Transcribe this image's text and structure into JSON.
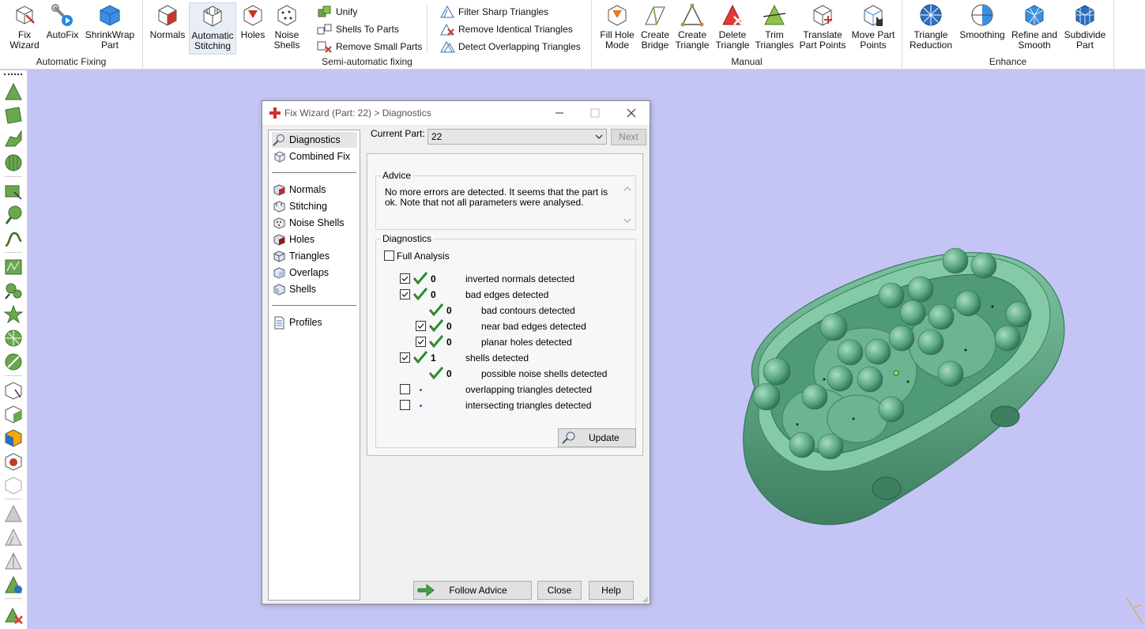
{
  "ribbon": {
    "groups": [
      {
        "label": "Automatic Fixing",
        "buttons": [
          {
            "label": "Fix\nWizard",
            "icon": "fix-wizard-icon"
          },
          {
            "label": "AutoFix",
            "icon": "autofix-icon"
          },
          {
            "label": "ShrinkWrap\nPart",
            "icon": "shrinkwrap-icon"
          }
        ]
      },
      {
        "label": "Semi-automatic fixing",
        "buttons": [
          {
            "label": "Normals",
            "icon": "normals-icon"
          },
          {
            "label": "Automatic\nStitching",
            "icon": "stitching-icon"
          },
          {
            "label": "Holes",
            "icon": "holes-icon"
          },
          {
            "label": "Noise\nShells",
            "icon": "noise-shells-icon"
          }
        ],
        "small_buttons": [
          {
            "label": "Unify"
          },
          {
            "label": "Shells To Parts"
          },
          {
            "label": "Remove Small Parts"
          },
          {
            "label": "Filter Sharp Triangles"
          },
          {
            "label": "Remove Identical Triangles"
          },
          {
            "label": "Detect Overlapping Triangles"
          }
        ]
      },
      {
        "label": "Manual",
        "buttons": [
          {
            "label": "Fill Hole\nMode"
          },
          {
            "label": "Create\nBridge"
          },
          {
            "label": "Create\nTriangle"
          },
          {
            "label": "Delete\nTriangle"
          },
          {
            "label": "Trim\nTriangles"
          },
          {
            "label": "Translate\nPart Points"
          },
          {
            "label": "Move Part\nPoints"
          }
        ]
      },
      {
        "label": "Enhance",
        "buttons": [
          {
            "label": "Triangle\nReduction"
          },
          {
            "label": "Smoothing"
          },
          {
            "label": "Refine and\nSmooth"
          },
          {
            "label": "Subdivide\nPart"
          }
        ]
      }
    ]
  },
  "dialog": {
    "title": "Fix Wizard (Part: 22) > Diagnostics",
    "nav": {
      "top": [
        "Diagnostics",
        "Combined Fix"
      ],
      "middle": [
        "Normals",
        "Stitching",
        "Noise Shells",
        "Holes",
        "Triangles",
        "Overlaps",
        "Shells"
      ],
      "bottom": [
        "Profiles"
      ]
    },
    "current_part_label": "Current Part:",
    "current_part_value": "22",
    "next_label": "Next",
    "advice_legend": "Advice",
    "advice_text": "No more errors are detected. It seems that the part is ok. Note that not all parameters were analysed.",
    "diagnostics_legend": "Diagnostics",
    "full_analysis_label": "Full Analysis",
    "rows": [
      {
        "count": "0",
        "label": "inverted normals detected"
      },
      {
        "count": "0",
        "label": "bad edges detected"
      },
      {
        "count": "0",
        "label": "bad contours detected"
      },
      {
        "count": "0",
        "label": "near bad edges detected"
      },
      {
        "count": "0",
        "label": "planar holes detected"
      },
      {
        "count": "1",
        "label": "shells detected"
      },
      {
        "count": "0",
        "label": "possible noise shells detected"
      },
      {
        "count": "",
        "label": "overlapping triangles detected"
      },
      {
        "count": "",
        "label": "intersecting triangles detected"
      }
    ],
    "update_label": "Update",
    "follow_advice_label": "Follow Advice",
    "close_label": "Close",
    "help_label": "Help"
  },
  "colors": {
    "viewport_bg": "#c4c4f5",
    "model_green": "#5aa883",
    "check_green": "#2e8b2e"
  }
}
